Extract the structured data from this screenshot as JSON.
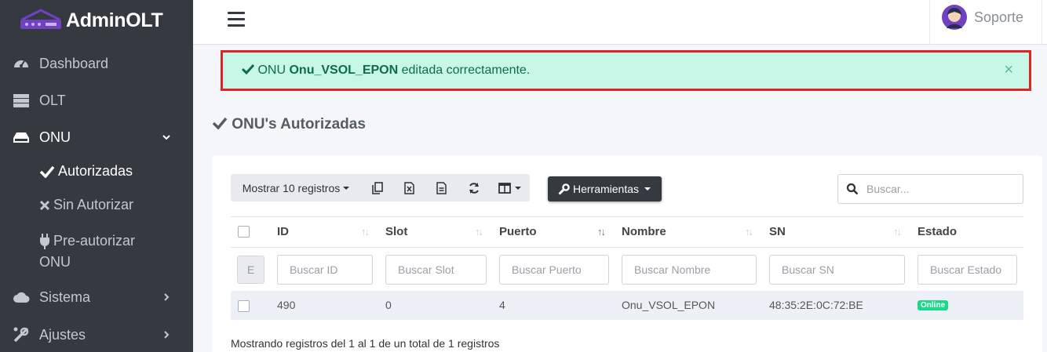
{
  "app": {
    "brand": "AdminOLT"
  },
  "sidebar": {
    "items": [
      {
        "label": "Dashboard",
        "icon": "tachometer-icon"
      },
      {
        "label": "OLT",
        "icon": "server-icon"
      },
      {
        "label": "ONU",
        "icon": "hdd-icon"
      },
      {
        "label": "Sistema",
        "icon": "cloud-icon"
      },
      {
        "label": "Ajustes",
        "icon": "tools-icon"
      }
    ],
    "onu_sub": [
      {
        "label": "Autorizadas",
        "icon": "check-icon"
      },
      {
        "label": "Sin Autorizar",
        "icon": "times-icon"
      },
      {
        "label": "Pre-autorizar",
        "label2": "ONU",
        "icon": "plug-icon"
      }
    ]
  },
  "topbar": {
    "user": "Soporte"
  },
  "alert": {
    "prefix": "ONU",
    "onu_name": "Onu_VSOL_EPON",
    "suffix": "editada correctamente.",
    "close": "×"
  },
  "page": {
    "title": "ONU's Autorizadas"
  },
  "toolbar": {
    "show_records": "Mostrar 10 registros",
    "tools": "Herramientas",
    "search_placeholder": "Buscar..."
  },
  "table": {
    "columns": [
      "ID",
      "Slot",
      "Puerto",
      "Nombre",
      "SN",
      "Estado"
    ],
    "filter_button": "E",
    "filters": [
      "Buscar ID",
      "Buscar Slot",
      "Buscar Puerto",
      "Buscar Nombre",
      "Buscar SN",
      "Buscar Estado"
    ],
    "rows": [
      {
        "id": "490",
        "slot": "0",
        "puerto": "4",
        "nombre": "Onu_VSOL_EPON",
        "sn": "48:35:2E:0C:72:BE",
        "estado": "Online"
      }
    ],
    "footer": "Mostrando registros del 1 al 1 de un total de 1 registros"
  },
  "colors": {
    "sidebar": "#343a40",
    "alert_bg": "#c7f7e6",
    "alert_border": "#e02424",
    "online": "#1ad98a"
  }
}
